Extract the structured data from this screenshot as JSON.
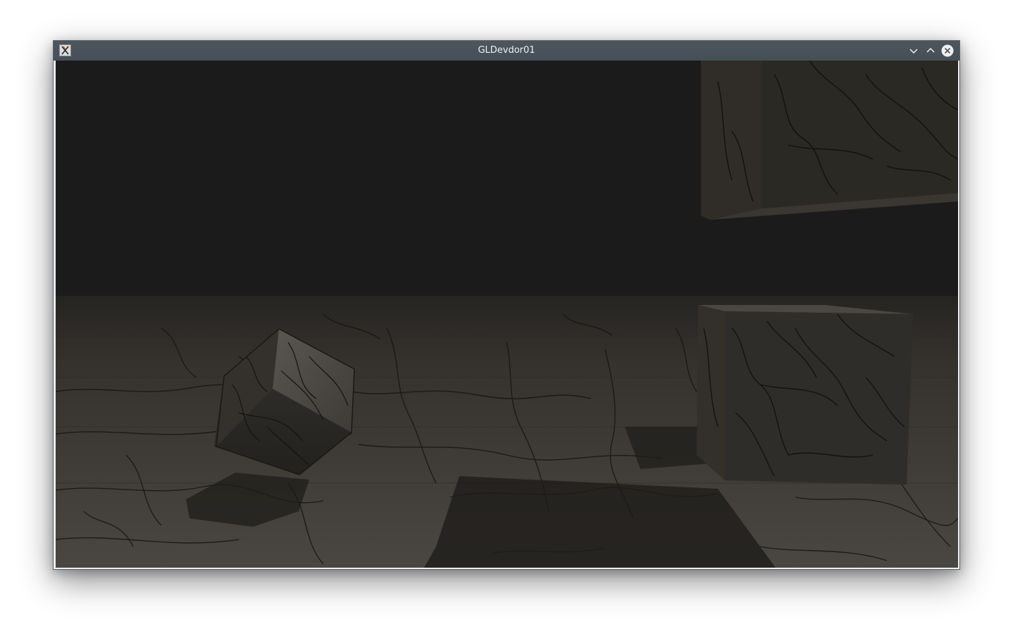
{
  "window": {
    "title": "GLDevdor01",
    "icon": "x11-app-icon",
    "controls": {
      "minimize": "chevron-down-icon",
      "maximize": "chevron-up-icon",
      "close": "close-icon"
    }
  },
  "scene": {
    "background_color": "#1b1b1b",
    "floor_color": "#3f3c38",
    "crack_color": "#16140f",
    "objects": [
      "floor-plane",
      "tilted-cube",
      "right-cube",
      "overhead-cube"
    ]
  }
}
